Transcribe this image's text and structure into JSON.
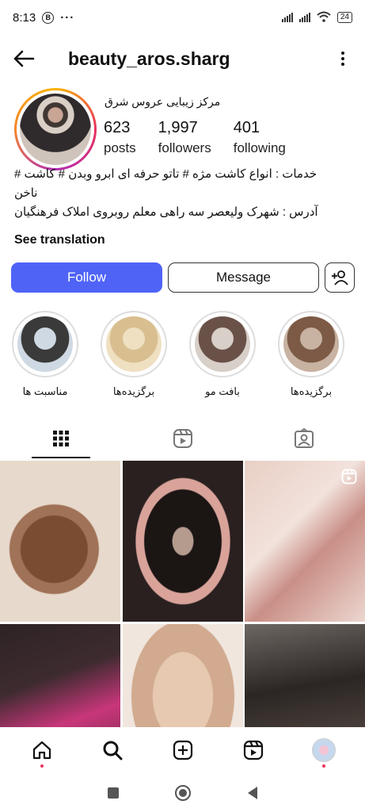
{
  "status_bar": {
    "time": "8:13",
    "badge": "B",
    "more": "···",
    "network_sub": "4",
    "wifi_sub": "6",
    "battery": "24"
  },
  "header": {
    "username": "beauty_aros.sharg"
  },
  "profile": {
    "full_name": "مرکز زیبایی عروس شرق",
    "stats": [
      {
        "value": "623",
        "label": "posts"
      },
      {
        "value": "1,997",
        "label": "followers"
      },
      {
        "value": "401",
        "label": "following"
      }
    ],
    "bio_lines": [
      "خدمات : انواع کاشت مژه # تاتو حرفه ای ابرو وبدن # کاشت #",
      "ناخن",
      "آدرس : شهرک ولیعصر سه راهی معلم روبروی املاک فرهنگیان"
    ],
    "see_translation": "See translation"
  },
  "actions": {
    "follow": "Follow",
    "message": "Message"
  },
  "highlights": [
    {
      "label": "مناسبت ها",
      "colors": [
        "#3a3a3a",
        "#cfd9e3"
      ]
    },
    {
      "label": "برگزیده‌ها",
      "colors": [
        "#d9bf90",
        "#efe0c2"
      ]
    },
    {
      "label": "بافت مو",
      "colors": [
        "#6a5148",
        "#d7cfc8"
      ]
    },
    {
      "label": "برگزیده‌ها",
      "colors": [
        "#7c5a45",
        "#c8b2a2"
      ]
    }
  ],
  "tabs": [
    "grid-icon",
    "reels-icon",
    "tagged-icon"
  ],
  "accent_color": "#4f63f7"
}
